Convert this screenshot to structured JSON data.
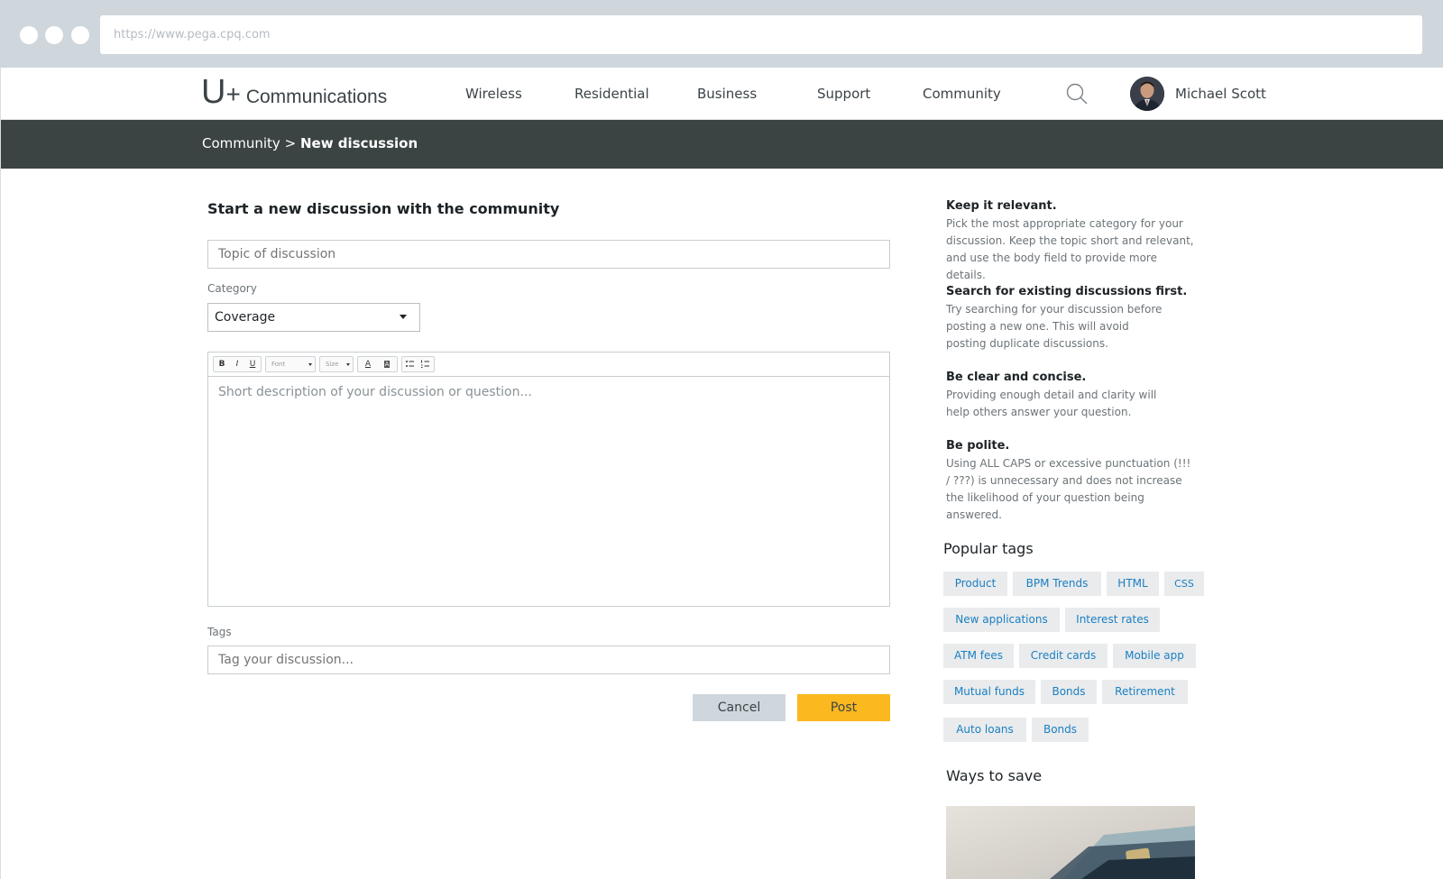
{
  "browser": {
    "url": "https://www.pega.cpq.com"
  },
  "header": {
    "logo_u": "U",
    "logo_plus": "+",
    "logo_name": "Communications",
    "nav": [
      "Wireless",
      "Residential",
      "Business",
      "Support",
      "Community"
    ],
    "user_name": "Michael Scott"
  },
  "breadcrumb": {
    "parent": "Community",
    "separator": ">",
    "current": "New discussion"
  },
  "form": {
    "title": "Start a new discussion with the community",
    "topic_placeholder": "Topic of discussion",
    "category_label": "Category",
    "category_value": "Coverage",
    "editor_toolbar": {
      "bold": "B",
      "italic": "I",
      "underline": "U",
      "font": "Font",
      "size": "Size",
      "text_color": "A",
      "bg_color": "A"
    },
    "body_placeholder": "Short description of your discussion or question...",
    "tags_label": "Tags",
    "tags_placeholder": "Tag your discussion...",
    "cancel_label": "Cancel",
    "post_label": "Post"
  },
  "sidebar": {
    "tips": [
      {
        "title": "Keep it relevant.",
        "body": "Pick the most appropriate category for your discussion. Keep the topic short and relevant, and use the body field to provide more details."
      },
      {
        "title": "Search for existing discussions first.",
        "body": "Try searching for your discussion before posting a new one. This will avoid posting duplicate discussions."
      },
      {
        "title": "Be clear and concise.",
        "body": "Providing enough detail and clarity will help others answer your question."
      },
      {
        "title": "Be polite.",
        "body": "Using ALL CAPS or excessive punctuation (!!! / ???) is unnecessary and does not increase the likelihood of your question being answered."
      }
    ],
    "popular_tags_title": "Popular tags",
    "tags": [
      "Product",
      "BPM Trends",
      "HTML",
      "CSS",
      "New applications",
      "Interest rates",
      "ATM fees",
      "Credit cards",
      "Mobile app",
      "Mutual funds",
      "Bonds",
      "Retirement",
      "Auto loans",
      "Bonds"
    ],
    "ways_to_save_title": "Ways to save"
  },
  "colors": {
    "chrome": "#cfd6dc",
    "breadcrumb_bar": "#3b4442",
    "post_button": "#fbb81f",
    "tag_text": "#1a7fc1",
    "tag_bg": "#e9ebed"
  }
}
